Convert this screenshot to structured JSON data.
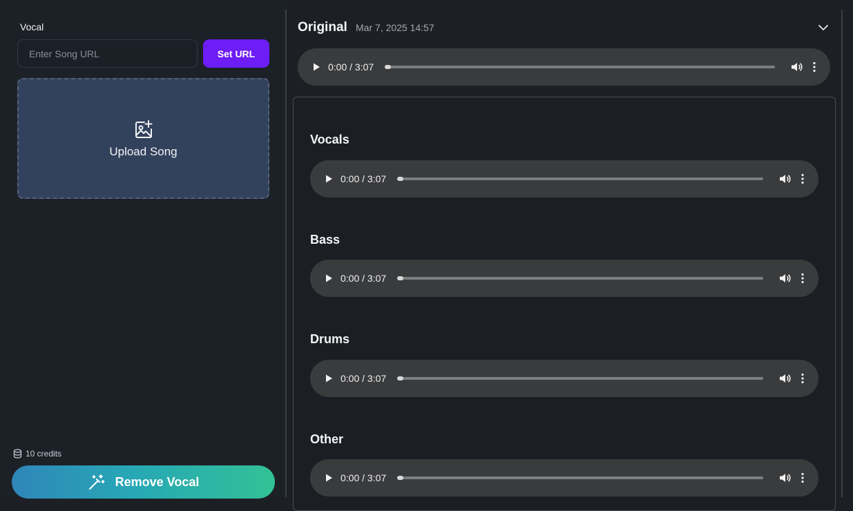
{
  "left": {
    "section_label": "Vocal",
    "url_input": {
      "placeholder": "Enter Song URL",
      "value": ""
    },
    "set_url_label": "Set URL",
    "upload_label": "Upload Song",
    "credits_text": "10 credits",
    "remove_label": "Remove Vocal"
  },
  "original": {
    "title": "Original",
    "date": "Mar 7, 2025 14:57",
    "player": {
      "time": "0:00 / 3:07",
      "progress": 0
    }
  },
  "stems": [
    {
      "name": "Vocals",
      "time": "0:00 / 3:07",
      "progress": 0
    },
    {
      "name": "Bass",
      "time": "0:00 / 3:07",
      "progress": 0
    },
    {
      "name": "Drums",
      "time": "0:00 / 3:07",
      "progress": 0
    },
    {
      "name": "Other",
      "time": "0:00 / 3:07",
      "progress": 0
    }
  ],
  "colors": {
    "accent": "#6d1df5",
    "upload_bg": "#33425c",
    "player_bg": "#3a3b3d",
    "remove_gradient_start": "#2f86b8",
    "remove_gradient_end": "#32c196"
  },
  "icons": [
    "add-image-icon",
    "database-icon",
    "magic-wand-icon",
    "chevron-down-icon",
    "play-icon",
    "volume-icon",
    "more-vertical-icon"
  ]
}
